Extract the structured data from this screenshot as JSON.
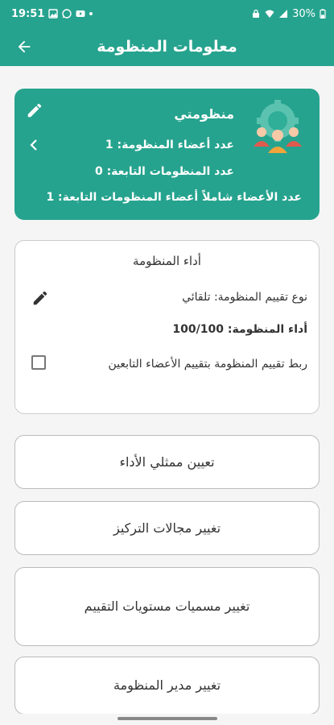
{
  "status_bar": {
    "time": "19:51",
    "battery": "30%",
    "left_icons": [
      "gallery-icon",
      "whatsapp-icon",
      "youtube-icon",
      "dot-icon"
    ],
    "right_icons": [
      "lock-icon",
      "wifi-icon",
      "signal-icon",
      "battery-icon"
    ]
  },
  "app_bar": {
    "title": "معلومات المنظومة",
    "back_icon": "arrow-left-icon"
  },
  "system_card": {
    "name": "منظومتي",
    "members_count_label": "عدد أعضاء المنظومة: 1",
    "subsystems_count_label": "عدد المنظومات التابعة: 0",
    "total_members_label": "عدد الأعضاء شاملاً أعضاء المنظومات التابعة: 1",
    "logo_icon": "team-gear-icon",
    "edit_icon": "pencil-icon",
    "chevron_icon": "chevron-left-icon"
  },
  "performance_card": {
    "title": "أداء المنظومة",
    "evaluation_type": "نوع تقييم المنظومة: تلقائي",
    "performance_value": "أداء المنظومة: 100/100",
    "link_evaluation": "ربط تقييم المنظومة بتقييم الأعضاء التابعين",
    "edit_icon": "pencil-icon",
    "link_checked": false
  },
  "actions": {
    "assign_representatives": "تعيين ممثلي الأداء",
    "change_focus_areas": "تغيير مجالات التركيز",
    "change_evaluation_levels": "تغيير مسميات مستويات التقييم",
    "change_manager": "تغيير مدير المنظومة"
  },
  "colors": {
    "primary": "#26a38e",
    "background": "#f5f5f5"
  }
}
